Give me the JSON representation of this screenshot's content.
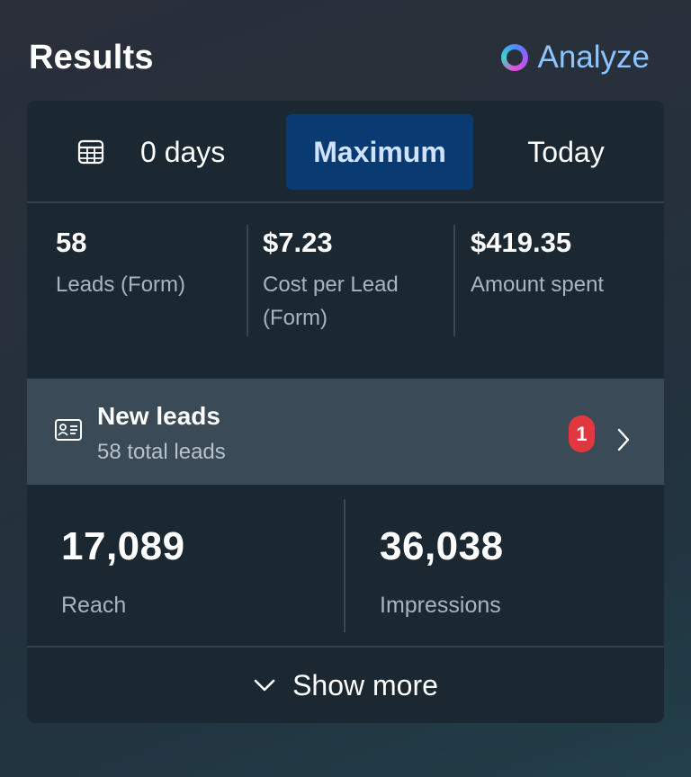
{
  "header": {
    "title": "Results",
    "analyze_label": "Analyze"
  },
  "date_range": {
    "custom_label": "0 days",
    "tabs": [
      {
        "label": "Maximum",
        "selected": true
      },
      {
        "label": "Today",
        "selected": false
      }
    ]
  },
  "summary_stats": [
    {
      "value": "58",
      "label": "Leads (Form)"
    },
    {
      "value": "$7.23",
      "label": "Cost per Lead (Form)"
    },
    {
      "value": "$419.35",
      "label": "Amount spent"
    }
  ],
  "new_leads": {
    "title": "New leads",
    "subtitle": "58 total leads",
    "badge_count": "1"
  },
  "metrics": [
    {
      "value": "17,089",
      "label": "Reach"
    },
    {
      "value": "36,038",
      "label": "Impressions"
    }
  ],
  "footer": {
    "show_more_label": "Show more"
  },
  "colors": {
    "accent_tab_bg": "#0a3a72",
    "accent_tab_text": "#cfe3ff",
    "analyze_text": "#8ec5ff",
    "badge": "#e0383e",
    "card_bg": "#1c2831",
    "leads_row_bg": "#3a4a56"
  }
}
